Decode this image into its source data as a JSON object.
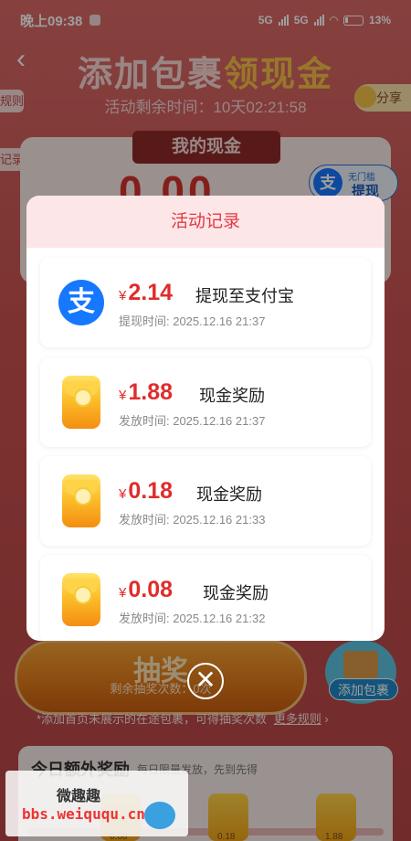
{
  "status_bar": {
    "time": "晚上09:38",
    "net1": "5G",
    "net2": "5G",
    "battery": "13%"
  },
  "header": {
    "title_part1": "添加包裹",
    "title_part2": "领现金",
    "remaining": "活动剩余时间：10天02:21:58",
    "rules_tab": "规则",
    "records_tab": "记录",
    "share": "分享"
  },
  "cash": {
    "label": "我的现金",
    "amount": "0.00",
    "withdraw_line1": "无门槛",
    "withdraw_line2": "提现",
    "alipay_glyph": "支"
  },
  "draw": {
    "label": "抽奖",
    "sub": "剩余抽奖次数：0次"
  },
  "add_package": {
    "label": "添加包裹"
  },
  "hint": {
    "text": "*添加首页未展示的在途包裹，可得抽奖次数",
    "more": "更多规则",
    "arrow": "›"
  },
  "bonus": {
    "title": "今日额外奖励",
    "subtitle": "每日限量发放，先到先得",
    "values": [
      "0.08",
      "0.18",
      "1.88"
    ]
  },
  "watermark": {
    "line1": "微趣趣",
    "line2": "bbs.weiququ.cn"
  },
  "modal": {
    "title": "活动记录",
    "records": [
      {
        "type": "alipay",
        "icon_glyph": "支",
        "currency": "¥",
        "amount": "2.14",
        "desc": "提现至支付宝",
        "time": "提现时间: 2025.12.16 21:37"
      },
      {
        "type": "envelope",
        "currency": "¥",
        "amount": "1.88",
        "desc": "现金奖励",
        "time": "发放时间: 2025.12.16 21:37"
      },
      {
        "type": "envelope",
        "currency": "¥",
        "amount": "0.18",
        "desc": "现金奖励",
        "time": "发放时间: 2025.12.16 21:33"
      },
      {
        "type": "envelope",
        "currency": "¥",
        "amount": "0.08",
        "desc": "现金奖励",
        "time": "发放时间: 2025.12.16 21:32"
      }
    ],
    "close_glyph": "✕"
  },
  "icons": [
    "back-arrow-icon",
    "alipay-icon",
    "red-envelope-icon",
    "close-icon",
    "chick-icon",
    "package-icon"
  ],
  "colors": {
    "accent_red": "#e02c2c",
    "modal_header_bg": "#fde6e7",
    "alipay_blue": "#1677ff",
    "page_bg": "#c9504f"
  }
}
